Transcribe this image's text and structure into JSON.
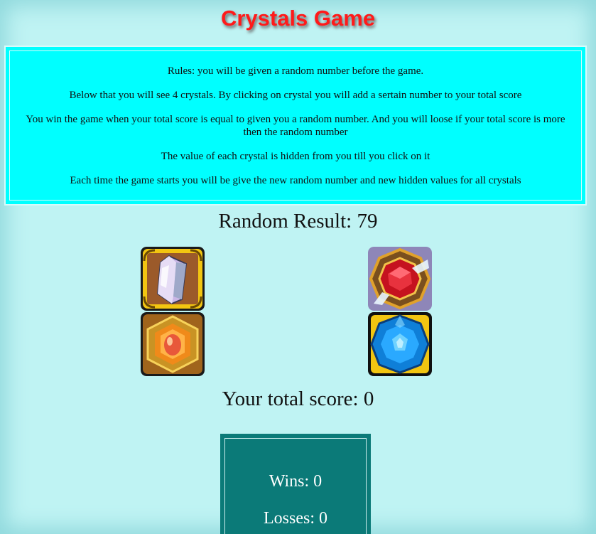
{
  "header": {
    "title": "Crystals Game"
  },
  "rules": {
    "lines": [
      "Rules: you will be given a random number before the game.",
      "Below that you will see 4 crystals. By clicking on crystal you will add a sertain number to your total score",
      "You win the game when your total score is equal to given you a random number. And you will loose if your total score is more then the random number",
      "The value of each crystal is hidden from you till you click on it",
      "Each time the game starts you will be give the new random number and new hidden values for all crystals"
    ]
  },
  "game": {
    "random_result": "Random Result: 79",
    "total_score": "Your total score: 0",
    "crystals": [
      {
        "icon": "white-crystal-icon"
      },
      {
        "icon": "red-gem-icon"
      },
      {
        "icon": "orange-crystal-icon"
      },
      {
        "icon": "blue-gem-icon"
      }
    ]
  },
  "stats": {
    "wins": "Wins: 0",
    "losses": "Losses: 0"
  },
  "colors": {
    "background": "#bff3f3",
    "rules_box": "#00ffff",
    "title": "#ff1a1a",
    "stats_box": "#0b7a78"
  }
}
